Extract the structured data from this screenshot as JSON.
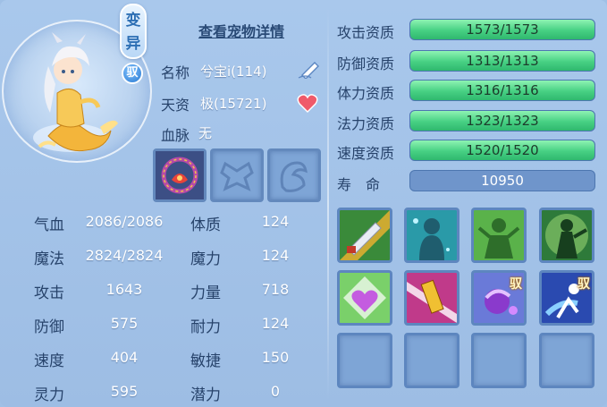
{
  "pet": {
    "variant_badge": [
      "变",
      "异"
    ],
    "ride_badge": "驭",
    "detail_link": "查看宠物详情",
    "name_label": "名称",
    "name_value": "兮宝i(114)",
    "talent_label": "天资",
    "talent_value": "极(15721)",
    "bloodline_label": "血脉",
    "bloodline_value": "无"
  },
  "stats": [
    {
      "label": "气血",
      "value": "2086/2086",
      "label2": "体质",
      "value2": "124"
    },
    {
      "label": "魔法",
      "value": "2824/2824",
      "label2": "魔力",
      "value2": "124"
    },
    {
      "label": "攻击",
      "value": "1643",
      "label2": "力量",
      "value2": "718"
    },
    {
      "label": "防御",
      "value": "575",
      "label2": "耐力",
      "value2": "124"
    },
    {
      "label": "速度",
      "value": "404",
      "label2": "敏捷",
      "value2": "150"
    },
    {
      "label": "灵力",
      "value": "595",
      "label2": "潜力",
      "value2": "0"
    }
  ],
  "aptitudes": [
    {
      "label": "攻击资质",
      "text": "1573/1573",
      "fill": 1.0
    },
    {
      "label": "防御资质",
      "text": "1313/1313",
      "fill": 1.0
    },
    {
      "label": "体力资质",
      "text": "1316/1316",
      "fill": 1.0
    },
    {
      "label": "法力资质",
      "text": "1323/1323",
      "fill": 1.0
    },
    {
      "label": "速度资质",
      "text": "1520/1520",
      "fill": 1.0
    }
  ],
  "lifespan": {
    "label": "寿　命",
    "value": "10950"
  },
  "skills": [
    {
      "icon": "sword-slash-skill-icon"
    },
    {
      "icon": "water-spirit-skill-icon"
    },
    {
      "icon": "green-aura-skill-icon"
    },
    {
      "icon": "shield-warrior-skill-icon"
    },
    {
      "icon": "heart-shield-skill-icon"
    },
    {
      "icon": "golden-blade-skill-icon"
    },
    {
      "icon": "purple-fist-skill-icon",
      "ride_mark": "驭"
    },
    {
      "icon": "swift-runner-skill-icon",
      "ride_mark": "驭"
    }
  ],
  "colors": {
    "panel_bg": "#a9c8ec",
    "bar_fill": "#47d083",
    "label_text": "#27436b"
  }
}
